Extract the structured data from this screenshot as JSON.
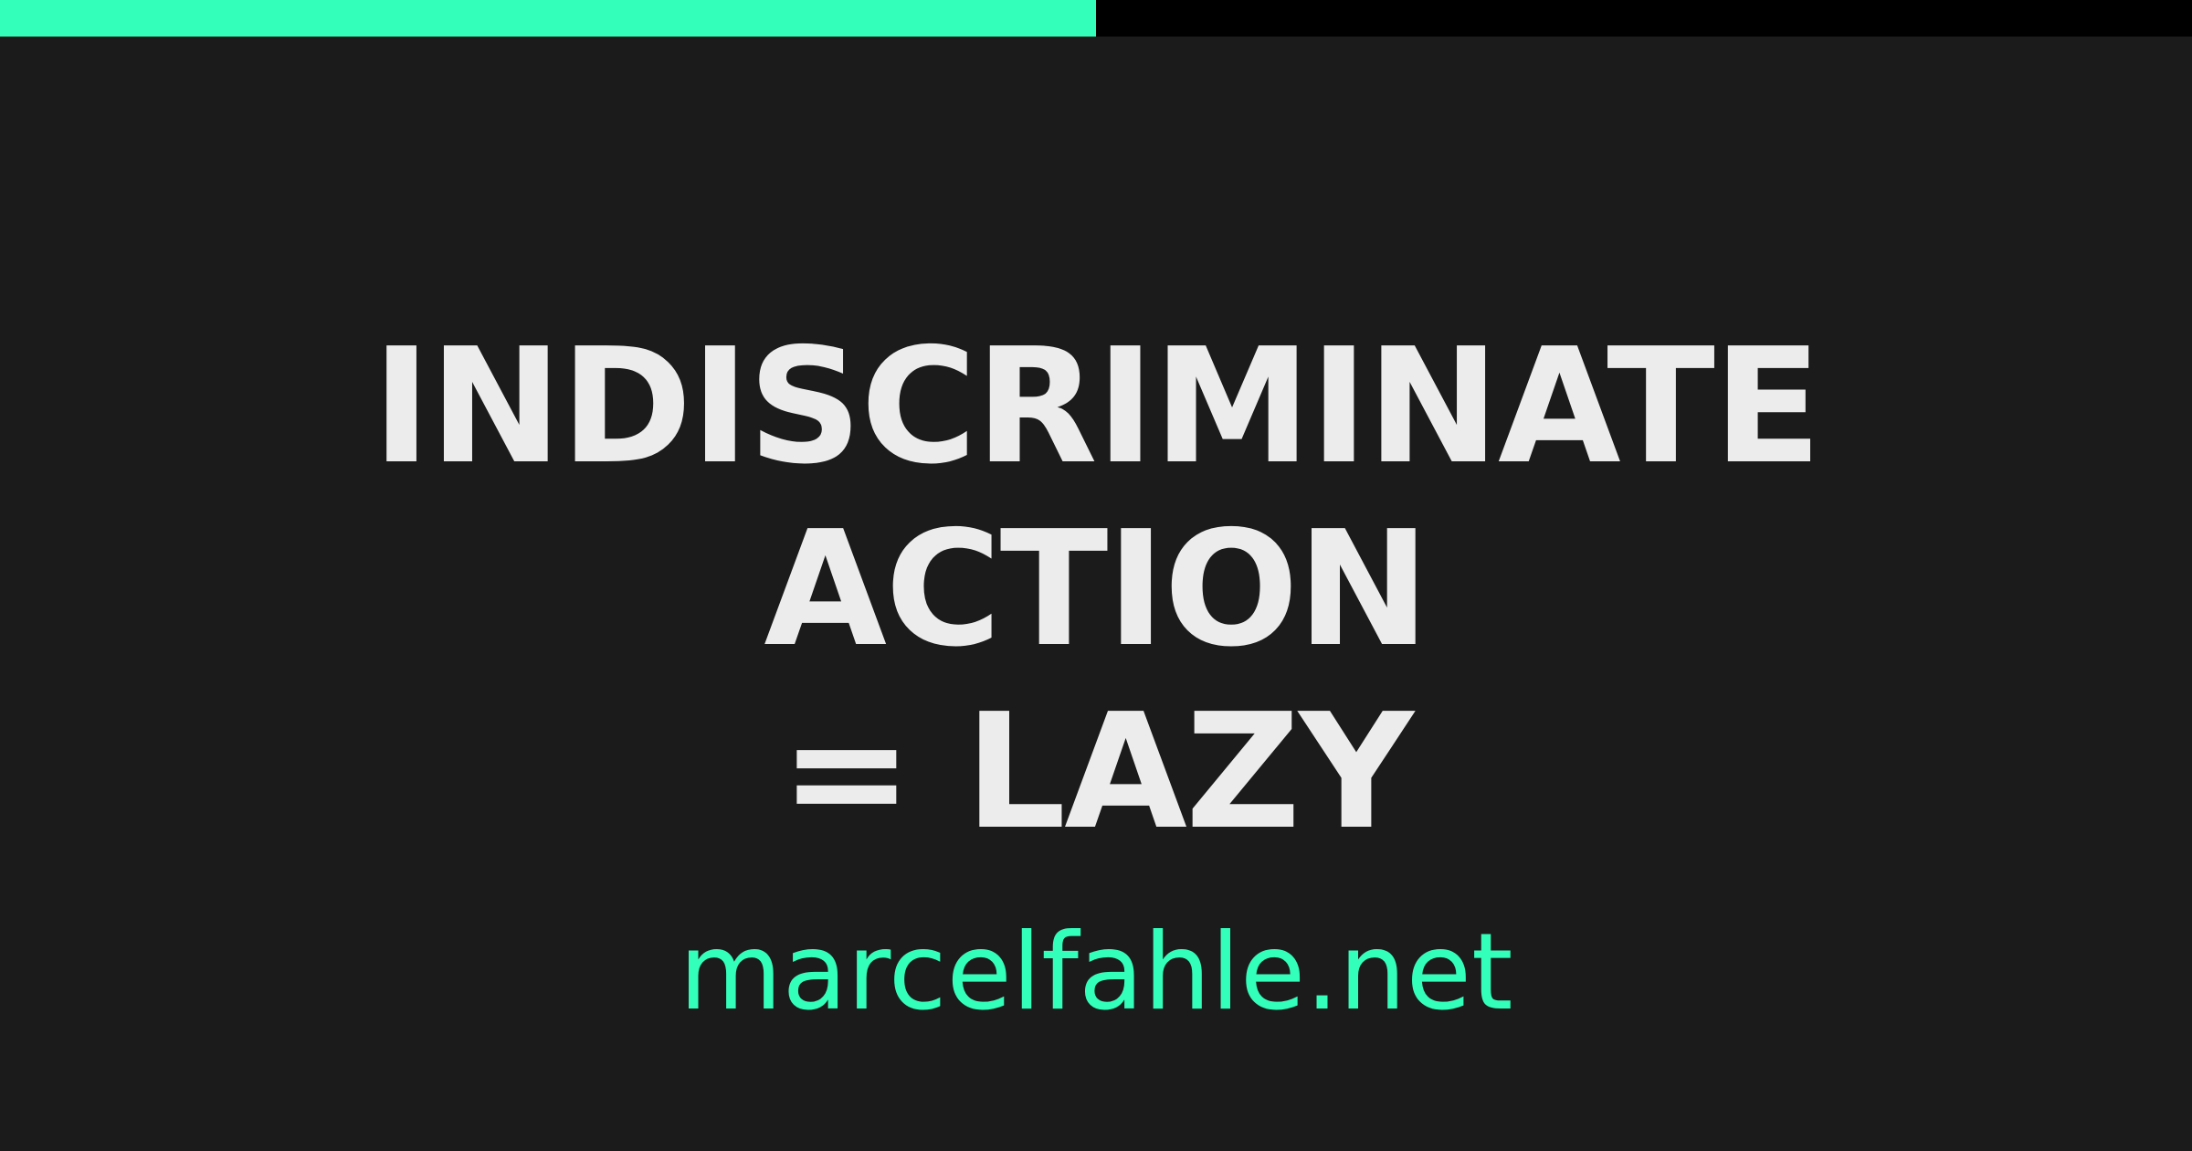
{
  "progress": {
    "fraction": 0.5
  },
  "headline": {
    "lines": [
      "INDISCRIMINATE",
      "ACTION",
      "= LAZY"
    ]
  },
  "footer": {
    "url": "marcelfahle.net"
  },
  "colors": {
    "accent": "#33ffbb",
    "background": "#1b1b1b",
    "strip": "#000000",
    "text": "#ececec"
  }
}
